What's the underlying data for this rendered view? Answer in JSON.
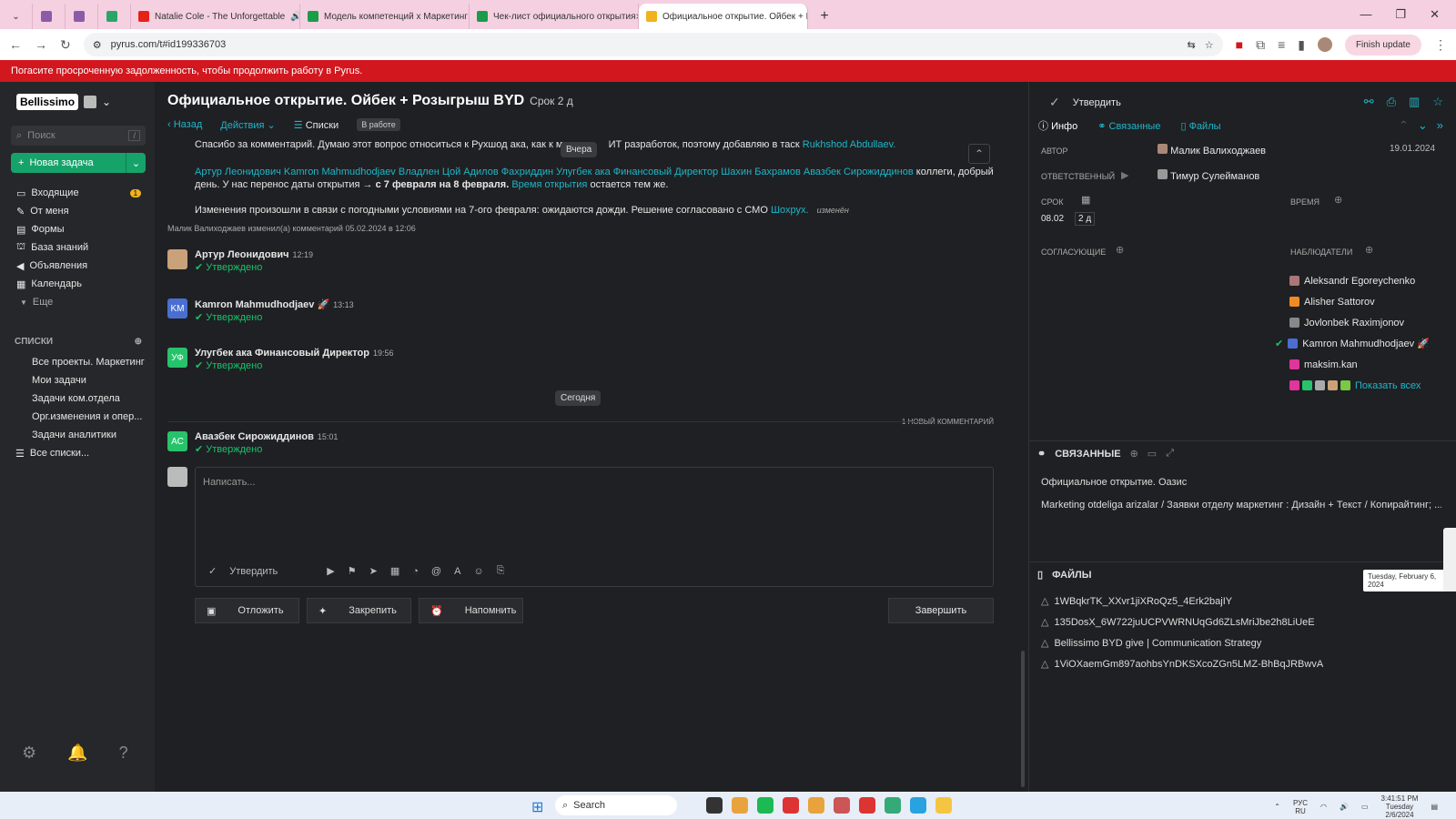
{
  "browser": {
    "tabs": [
      {
        "label": "",
        "color": "#8e5aa8"
      },
      {
        "label": "",
        "color": "#8e5aa8"
      },
      {
        "label": "",
        "color": "#2aa56a"
      },
      {
        "label": "Natalie Cole - The Unforgettable",
        "color": "#e62117"
      },
      {
        "label": "Модель компетенций х Маркетинг",
        "color": "#1a9c4a"
      },
      {
        "label": "Чек-лист официального открытия",
        "color": "#1a9c4a"
      },
      {
        "label": "Официальное открытие. Ойбек + Ро",
        "color": "#f0b21e"
      }
    ],
    "url": "pyrus.com/t#id199336703",
    "finish_update": "Finish update"
  },
  "banner": {
    "text": "Погасите просроченную задолженность, чтобы продолжить работу в Pyrus."
  },
  "sidebar": {
    "logo": "Bellissimo",
    "search_placeholder": "Поиск",
    "search_key": "/",
    "new_task": "Новая задача",
    "nav": [
      {
        "label": "Входящие",
        "icon": "inbox-icon",
        "badge": "1"
      },
      {
        "label": "От меня",
        "icon": "pencil-icon"
      },
      {
        "label": "Формы",
        "icon": "forms-icon"
      },
      {
        "label": "База знаний",
        "icon": "book-icon"
      },
      {
        "label": "Объявления",
        "icon": "megaphone-icon"
      },
      {
        "label": "Календарь",
        "icon": "calendar-icon"
      },
      {
        "label": "Еще",
        "icon": "chevron-down-icon"
      }
    ],
    "lists_header": "СПИСКИ",
    "lists": [
      "Все проекты. Маркетинг",
      "Мои задачи",
      "Задачи ком.отдела",
      "Орг.изменения и опер...",
      "Задачи аналитики",
      "Все списки..."
    ]
  },
  "main": {
    "title": "Официальное открытие. Ойбек + Розыгрыш BYD",
    "due": "Срок 2 д",
    "back": "Назад",
    "actions": "Действия",
    "lists": "Списки",
    "status": "В работе",
    "comment_line1_a": "Спасибо за комментарий. Думаю этот вопрос относиться к Рухшод ака, как к ме",
    "comment_line1_b": "ИТ разработок, поэтому добавляю в таск",
    "comment_line1_link": "Rukhshod Abdullaev.",
    "yesterday_chip": "Вчера",
    "comment_mentions": "Артур Леонидович Kamron Mahmudhodjaev Владлен Цой Адилов Фахриддин Улугбек ака Финансовый Директор Шахин Бахрамов Авазбек Сирожиддинов",
    "comment_p2_a": "коллеги, добрый день. У нас перенос даты открытия →",
    "comment_p2_bold": "с 7 февраля на 8 февраля.",
    "comment_p2_link": "Время открытия",
    "comment_p2_b": "остается тем же.",
    "comment_p3": "Изменения произошли в связи с погодными условиями на 7-ого февраля: ожидаются дожди. Решение согласовано с СМО",
    "comment_p3_link": "Шохрух.",
    "comment_p3_edited": "изменён",
    "edit_meta": "Малик Валиходжаев изменил(а) комментарий 05.02.2024 в 12:06",
    "approvals": [
      {
        "name": "Артур Леонидович",
        "time": "12:19",
        "status": "Утверждено",
        "initials": "",
        "color": "#c9a27a"
      },
      {
        "name": "Kamron Mahmudhodjaev 🚀",
        "time": "13:13",
        "status": "Утверждено",
        "initials": "KM",
        "color": "#4a6fd1"
      },
      {
        "name": "Улугбек ака Финансовый Директор",
        "time": "19:56",
        "status": "Утверждено",
        "initials": "УФ",
        "color": "#27c36b"
      }
    ],
    "today_chip": "Сегодня",
    "new_comment": "1 НОВЫЙ КОММЕНТАРИЙ",
    "last_approval": {
      "name": "Авазбек Сирожиддинов",
      "time": "15:01",
      "status": "Утверждено",
      "initials": "АС",
      "color": "#27c36b"
    },
    "editor_placeholder": "Написать...",
    "approve": "Утвердить",
    "postpone": "Отложить",
    "pin": "Закрепить",
    "remind": "Напомнить",
    "finish": "Завершить"
  },
  "right": {
    "approve": "Утвердить",
    "tabs": [
      "Инфо",
      "Связанные",
      "Файлы"
    ],
    "author_label": "АВТОР",
    "author": "Малик Валиходжаев",
    "author_date": "19.01.2024",
    "responsible_label": "ОТВЕТСТВЕННЫЙ",
    "responsible": "Тимур Сулейманов",
    "due_label": "СРОК",
    "due_date": "08.02",
    "due_left": "2 д",
    "time_label": "ВРЕМЯ",
    "approvers_label": "СОГЛАСУЮЩИЕ",
    "observers_label": "НАБЛЮДАТЕЛИ",
    "observers": [
      {
        "name": "Aleksandr Egoreychenko",
        "color": "#a77"
      },
      {
        "name": "Alisher Sattorov",
        "color": "#f08a24"
      },
      {
        "name": "Jovlonbek Raximjonov",
        "color": "#888"
      },
      {
        "name": "Kamron Mahmudhodjaev 🚀",
        "color": "#4a6fd1"
      },
      {
        "name": "maksim.kan",
        "color": "#e0359b"
      }
    ],
    "show_all": "Показать всех",
    "related_header": "СВЯЗАННЫЕ",
    "related": [
      "Официальное открытие. Оазис",
      "Marketing otdeliga arizalar / Заявки отделу маркетинг : Дизайн + Текст / Копирайтинг; ..."
    ],
    "files_header": "ФАЙЛЫ",
    "files": [
      "1WBqkrTK_XXvr1jiXRoQz5_4Erk2bajIY",
      "135DosX_6W722juUCPVWRNUqGd6ZLsMriJbe2h8LiUeE",
      "Bellissimo BYD give | Communication Strategy",
      "1ViOXaemGm897aohbsYnDKSXcoZGn5LMZ-BhBqJRBwvA"
    ],
    "tooltip": "Tuesday, February 6, 2024"
  },
  "taskbar": {
    "search": "Search",
    "lang": "РУС\nRU",
    "time": "3:41:51 PM",
    "day": "Tuesday",
    "date": "2/6/2024"
  }
}
